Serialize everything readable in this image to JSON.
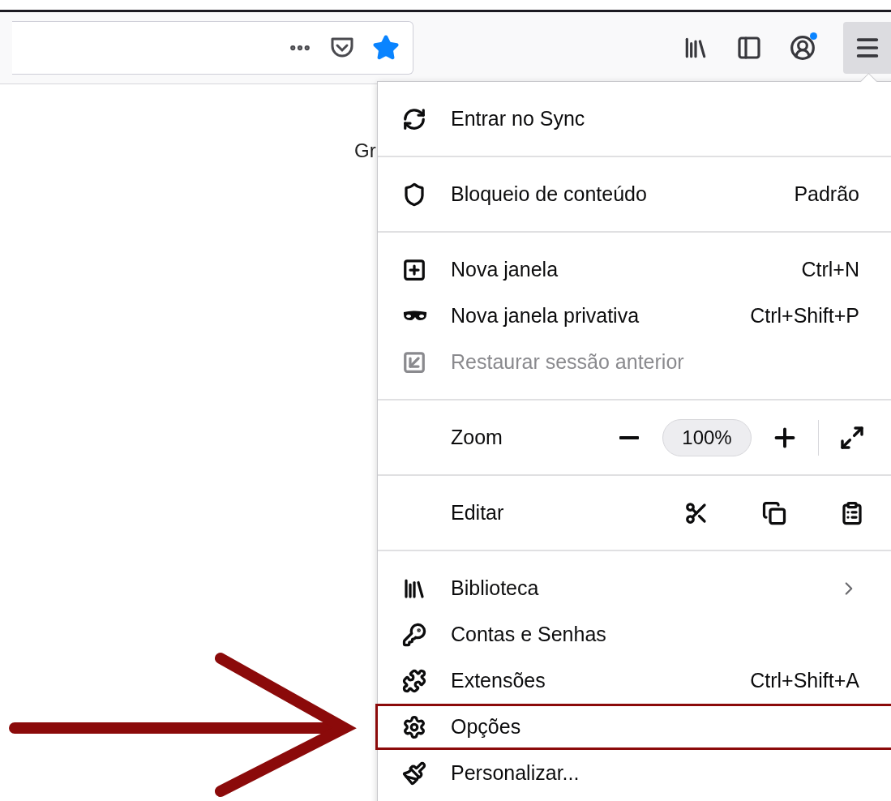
{
  "toolbar": {
    "bookmarked": true,
    "account_badge": true,
    "menu_open": true
  },
  "page": {
    "text": "Gr"
  },
  "menu": {
    "sections": [
      {
        "items": [
          {
            "kind": "item",
            "label": "Entrar no Sync",
            "disabled": false,
            "highlighted": false,
            "submenu": false
          }
        ]
      },
      {
        "items": [
          {
            "kind": "item",
            "label": "Bloqueio de conteúdo",
            "shortcut": "Padrão",
            "disabled": false,
            "highlighted": false,
            "submenu": false
          }
        ]
      },
      {
        "items": [
          {
            "kind": "item",
            "label": "Nova janela",
            "shortcut": "Ctrl+N",
            "disabled": false,
            "highlighted": false,
            "submenu": false
          },
          {
            "kind": "item",
            "label": "Nova janela privativa",
            "shortcut": "Ctrl+Shift+P",
            "disabled": false,
            "highlighted": false,
            "submenu": false
          },
          {
            "kind": "item",
            "label": "Restaurar sessão anterior",
            "disabled": true,
            "highlighted": false,
            "submenu": false
          }
        ]
      },
      {
        "items": [
          {
            "kind": "zoom",
            "label": "Zoom",
            "value": "100%"
          }
        ]
      },
      {
        "items": [
          {
            "kind": "edit",
            "label": "Editar"
          }
        ]
      },
      {
        "items": [
          {
            "kind": "item",
            "label": "Biblioteca",
            "disabled": false,
            "highlighted": false,
            "submenu": true
          },
          {
            "kind": "item",
            "label": "Contas e Senhas",
            "disabled": false,
            "highlighted": false,
            "submenu": false
          },
          {
            "kind": "item",
            "label": "Extensões",
            "shortcut": "Ctrl+Shift+A",
            "disabled": false,
            "highlighted": false,
            "submenu": false
          },
          {
            "kind": "item",
            "label": "Opções",
            "disabled": false,
            "highlighted": true,
            "submenu": false
          },
          {
            "kind": "item",
            "label": "Personalizar...",
            "disabled": false,
            "highlighted": false,
            "submenu": false
          }
        ]
      }
    ]
  }
}
